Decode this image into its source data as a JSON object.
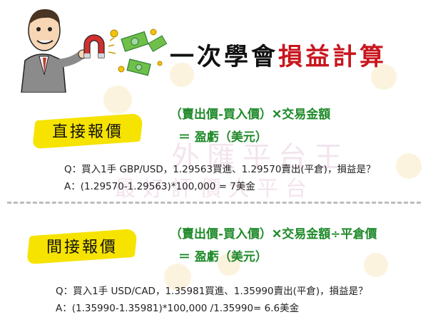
{
  "header": {
    "title_black": "一次學會",
    "title_red": "損益計算"
  },
  "watermark": {
    "line1": "外匯平台王",
    "line2": "最好評價大平台"
  },
  "direct": {
    "label": "直接報價",
    "formula_line1": "（賣出價-買入價）✕交易金額",
    "formula_line2": "＝ 盈虧（美元）",
    "question": "Q：買入1手 GBP/USD，1.29563買進、1.29570賣出(平倉)，損益是？",
    "answer": "A：(1.29570-1.29563)*100,000 = 7美金"
  },
  "indirect": {
    "label": "間接報價",
    "formula_line1": "（賣出價-買入價）✕交易金額÷平倉價",
    "formula_line2": "＝ 盈虧（美元）",
    "question": "Q：買入1手 USD/CAD，1.35981買進、1.35990賣出(平倉)，損益是？",
    "answer": "A：(1.35990-1.35981)*100,000 /1.35990= 6.6美金"
  },
  "colors": {
    "highlight": "#f6e300",
    "formula": "#1f8a2a",
    "title_red": "#c8161d"
  }
}
